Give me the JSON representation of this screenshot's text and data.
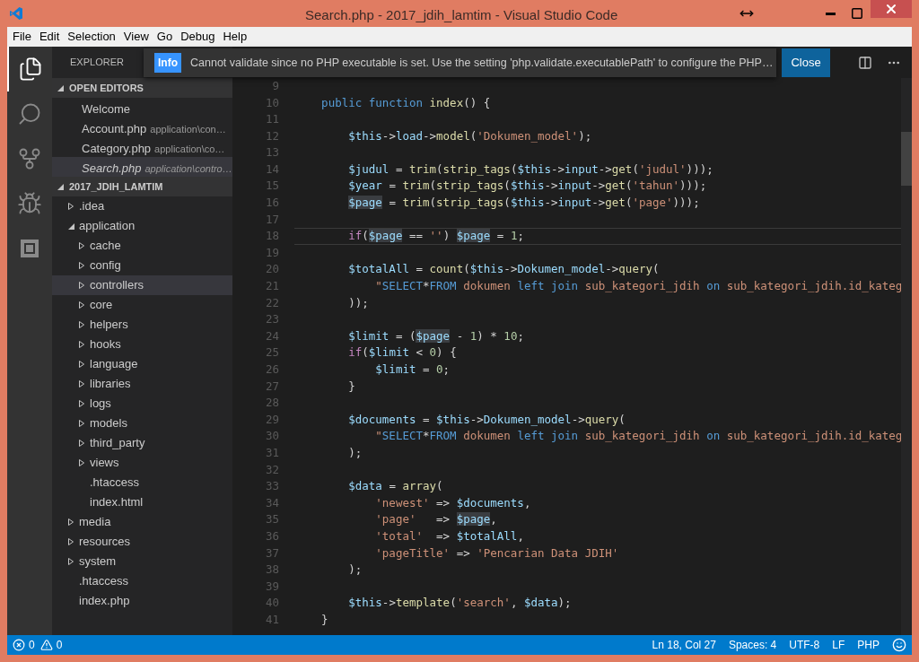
{
  "window": {
    "title": "Search.php - 2017_jdih_lamtim - Visual Studio Code"
  },
  "menu": [
    "File",
    "Edit",
    "Selection",
    "View",
    "Go",
    "Debug",
    "Help"
  ],
  "activity_bar": [
    {
      "kind": "files",
      "selected": true
    },
    {
      "kind": "search",
      "selected": false
    },
    {
      "kind": "git",
      "selected": false
    },
    {
      "kind": "debug",
      "selected": false
    },
    {
      "kind": "extensions",
      "selected": false
    }
  ],
  "notification": {
    "badge": "Info",
    "message": "Cannot validate since no PHP executable is set. Use the setting 'php.validate.executablePath' to configure the PHP…",
    "button": "Close"
  },
  "sidebar": {
    "title": "EXPLORER",
    "open_editors": {
      "title": "OPEN EDITORS",
      "expanded": true,
      "items": [
        {
          "name": "Welcome",
          "selected": false,
          "preview": false
        },
        {
          "name": "Account.php",
          "path": "application\\con…",
          "selected": false,
          "preview": false
        },
        {
          "name": "Category.php",
          "path": "application\\co…",
          "selected": false,
          "preview": false
        },
        {
          "name": "Search.php",
          "path": "application\\contro…",
          "selected": true,
          "preview": true
        }
      ]
    },
    "project": {
      "title": "2017_JDIH_LAMTIM",
      "expanded": true,
      "tree": [
        {
          "name": ".idea",
          "kind": "folder",
          "expanded": false,
          "selected": false
        },
        {
          "name": "application",
          "kind": "folder",
          "expanded": true,
          "selected": false,
          "children": [
            {
              "name": "cache",
              "kind": "folder",
              "expanded": false,
              "selected": false
            },
            {
              "name": "config",
              "kind": "folder",
              "expanded": false,
              "selected": false
            },
            {
              "name": "controllers",
              "kind": "folder",
              "expanded": false,
              "selected": true
            },
            {
              "name": "core",
              "kind": "folder",
              "expanded": false,
              "selected": false
            },
            {
              "name": "helpers",
              "kind": "folder",
              "expanded": false,
              "selected": false
            },
            {
              "name": "hooks",
              "kind": "folder",
              "expanded": false,
              "selected": false
            },
            {
              "name": "language",
              "kind": "folder",
              "expanded": false,
              "selected": false
            },
            {
              "name": "libraries",
              "kind": "folder",
              "expanded": false,
              "selected": false
            },
            {
              "name": "logs",
              "kind": "folder",
              "expanded": false,
              "selected": false
            },
            {
              "name": "models",
              "kind": "folder",
              "expanded": false,
              "selected": false
            },
            {
              "name": "third_party",
              "kind": "folder",
              "expanded": false,
              "selected": false
            },
            {
              "name": "views",
              "kind": "folder",
              "expanded": false,
              "selected": false
            },
            {
              "name": ".htaccess",
              "kind": "file",
              "selected": false
            },
            {
              "name": "index.html",
              "kind": "file",
              "selected": false
            }
          ]
        },
        {
          "name": "media",
          "kind": "folder",
          "expanded": false,
          "selected": false
        },
        {
          "name": "resources",
          "kind": "folder",
          "expanded": false,
          "selected": false
        },
        {
          "name": "system",
          "kind": "folder",
          "expanded": false,
          "selected": false
        },
        {
          "name": ".htaccess",
          "kind": "file",
          "selected": false
        },
        {
          "name": "index.php",
          "kind": "file",
          "selected": false
        }
      ]
    }
  },
  "editor": {
    "lines": [
      {
        "number": "9",
        "current": false
      },
      {
        "number": "10",
        "current": false,
        "tokens": [
          {
            "kind": "kw",
            "text": "    public function"
          },
          {
            "kind": "fn",
            "text": " index"
          },
          {
            "kind": "p",
            "text": "() {"
          }
        ]
      },
      {
        "number": "11",
        "current": false
      },
      {
        "number": "12",
        "current": false,
        "tokens": [
          {
            "kind": "var",
            "text": "        $this"
          },
          {
            "kind": "p",
            "text": "->"
          },
          {
            "kind": "var",
            "text": "load"
          },
          {
            "kind": "p",
            "text": "->"
          },
          {
            "kind": "fn",
            "text": "model"
          },
          {
            "kind": "p",
            "text": "("
          },
          {
            "kind": "str",
            "text": "'Dokumen_model'"
          },
          {
            "kind": "p",
            "text": ");"
          }
        ]
      },
      {
        "number": "13",
        "current": false
      },
      {
        "number": "14",
        "current": false,
        "tokens": [
          {
            "kind": "var",
            "text": "        $judul"
          },
          {
            "kind": "p",
            "text": " = "
          },
          {
            "kind": "fn",
            "text": "trim"
          },
          {
            "kind": "p",
            "text": "("
          },
          {
            "kind": "fn",
            "text": "strip_tags"
          },
          {
            "kind": "p",
            "text": "("
          },
          {
            "kind": "var",
            "text": "$this"
          },
          {
            "kind": "p",
            "text": "->"
          },
          {
            "kind": "var",
            "text": "input"
          },
          {
            "kind": "p",
            "text": "->"
          },
          {
            "kind": "fn",
            "text": "get"
          },
          {
            "kind": "p",
            "text": "("
          },
          {
            "kind": "str",
            "text": "'judul'"
          },
          {
            "kind": "p",
            "text": ")));"
          }
        ]
      },
      {
        "number": "15",
        "current": false,
        "tokens": [
          {
            "kind": "var",
            "text": "        $year"
          },
          {
            "kind": "p",
            "text": " = "
          },
          {
            "kind": "fn",
            "text": "trim"
          },
          {
            "kind": "p",
            "text": "("
          },
          {
            "kind": "fn",
            "text": "strip_tags"
          },
          {
            "kind": "p",
            "text": "("
          },
          {
            "kind": "var",
            "text": "$this"
          },
          {
            "kind": "p",
            "text": "->"
          },
          {
            "kind": "var",
            "text": "input"
          },
          {
            "kind": "p",
            "text": "->"
          },
          {
            "kind": "fn",
            "text": "get"
          },
          {
            "kind": "p",
            "text": "("
          },
          {
            "kind": "str",
            "text": "'tahun'"
          },
          {
            "kind": "p",
            "text": ")));"
          }
        ]
      },
      {
        "number": "16",
        "current": false,
        "tokens": [
          {
            "kind": "var",
            "text": "        $page",
            "highlighted": true
          },
          {
            "kind": "p",
            "text": " = "
          },
          {
            "kind": "fn",
            "text": "trim"
          },
          {
            "kind": "p",
            "text": "("
          },
          {
            "kind": "fn",
            "text": "strip_tags"
          },
          {
            "kind": "p",
            "text": "("
          },
          {
            "kind": "var",
            "text": "$this"
          },
          {
            "kind": "p",
            "text": "->"
          },
          {
            "kind": "var",
            "text": "input"
          },
          {
            "kind": "p",
            "text": "->"
          },
          {
            "kind": "fn",
            "text": "get"
          },
          {
            "kind": "p",
            "text": "("
          },
          {
            "kind": "str",
            "text": "'page'"
          },
          {
            "kind": "p",
            "text": ")));"
          }
        ]
      },
      {
        "number": "17",
        "current": false
      },
      {
        "number": "18",
        "current": true,
        "tokens": [
          {
            "kind": "ctl",
            "text": "        if"
          },
          {
            "kind": "p",
            "text": "("
          },
          {
            "kind": "var",
            "text": "$page",
            "highlighted": true
          },
          {
            "kind": "p",
            "text": " == "
          },
          {
            "kind": "str",
            "text": "''"
          },
          {
            "kind": "p",
            "text": ") "
          },
          {
            "kind": "var",
            "text": "$page",
            "highlighted": true
          },
          {
            "kind": "p",
            "text": " = "
          },
          {
            "kind": "num",
            "text": "1"
          },
          {
            "kind": "p",
            "text": ";"
          }
        ]
      },
      {
        "number": "19",
        "current": false
      },
      {
        "number": "20",
        "current": false,
        "tokens": [
          {
            "kind": "var",
            "text": "        $totalAll"
          },
          {
            "kind": "p",
            "text": " = "
          },
          {
            "kind": "fn",
            "text": "count"
          },
          {
            "kind": "p",
            "text": "("
          },
          {
            "kind": "var",
            "text": "$this"
          },
          {
            "kind": "p",
            "text": "->"
          },
          {
            "kind": "var",
            "text": "Dokumen_model"
          },
          {
            "kind": "p",
            "text": "->"
          },
          {
            "kind": "fn",
            "text": "query"
          },
          {
            "kind": "p",
            "text": "("
          }
        ]
      },
      {
        "number": "21",
        "current": false,
        "tokens": [
          {
            "kind": "str",
            "text": "            \""
          },
          {
            "kind": "kw",
            "text": "SELECT"
          },
          {
            "kind": "p",
            "text": "*"
          },
          {
            "kind": "kw",
            "text": "FROM"
          },
          {
            "kind": "str",
            "text": " dokumen "
          },
          {
            "kind": "kw",
            "text": "left join"
          },
          {
            "kind": "str",
            "text": " sub_kategori_jdih "
          },
          {
            "kind": "kw",
            "text": "on"
          },
          {
            "kind": "str",
            "text": " sub_kategori_jdih.id_kateg"
          }
        ]
      },
      {
        "number": "22",
        "current": false,
        "tokens": [
          {
            "kind": "p",
            "text": "        ));"
          }
        ]
      },
      {
        "number": "23",
        "current": false
      },
      {
        "number": "24",
        "current": false,
        "tokens": [
          {
            "kind": "var",
            "text": "        $limit"
          },
          {
            "kind": "p",
            "text": " = ("
          },
          {
            "kind": "var",
            "text": "$page",
            "highlighted": true
          },
          {
            "kind": "p",
            "text": " - "
          },
          {
            "kind": "num",
            "text": "1"
          },
          {
            "kind": "p",
            "text": ") * "
          },
          {
            "kind": "num",
            "text": "10"
          },
          {
            "kind": "p",
            "text": ";"
          }
        ]
      },
      {
        "number": "25",
        "current": false,
        "tokens": [
          {
            "kind": "ctl",
            "text": "        if"
          },
          {
            "kind": "p",
            "text": "("
          },
          {
            "kind": "var",
            "text": "$limit"
          },
          {
            "kind": "p",
            "text": " < "
          },
          {
            "kind": "num",
            "text": "0"
          },
          {
            "kind": "p",
            "text": ") {"
          }
        ]
      },
      {
        "number": "26",
        "current": false,
        "tokens": [
          {
            "kind": "var",
            "text": "            $limit"
          },
          {
            "kind": "p",
            "text": " = "
          },
          {
            "kind": "num",
            "text": "0"
          },
          {
            "kind": "p",
            "text": ";"
          }
        ]
      },
      {
        "number": "27",
        "current": false,
        "tokens": [
          {
            "kind": "p",
            "text": "        }"
          }
        ]
      },
      {
        "number": "28",
        "current": false
      },
      {
        "number": "29",
        "current": false,
        "tokens": [
          {
            "kind": "var",
            "text": "        $documents"
          },
          {
            "kind": "p",
            "text": " = "
          },
          {
            "kind": "var",
            "text": "$this"
          },
          {
            "kind": "p",
            "text": "->"
          },
          {
            "kind": "var",
            "text": "Dokumen_model"
          },
          {
            "kind": "p",
            "text": "->"
          },
          {
            "kind": "fn",
            "text": "query"
          },
          {
            "kind": "p",
            "text": "("
          }
        ]
      },
      {
        "number": "30",
        "current": false,
        "tokens": [
          {
            "kind": "str",
            "text": "            \""
          },
          {
            "kind": "kw",
            "text": "SELECT"
          },
          {
            "kind": "p",
            "text": "*"
          },
          {
            "kind": "kw",
            "text": "FROM"
          },
          {
            "kind": "str",
            "text": " dokumen "
          },
          {
            "kind": "kw",
            "text": "left join"
          },
          {
            "kind": "str",
            "text": " sub_kategori_jdih "
          },
          {
            "kind": "kw",
            "text": "on"
          },
          {
            "kind": "str",
            "text": " sub_kategori_jdih.id_kateg"
          }
        ]
      },
      {
        "number": "31",
        "current": false,
        "tokens": [
          {
            "kind": "p",
            "text": "        );"
          }
        ]
      },
      {
        "number": "32",
        "current": false
      },
      {
        "number": "33",
        "current": false,
        "tokens": [
          {
            "kind": "var",
            "text": "        $data"
          },
          {
            "kind": "p",
            "text": " = "
          },
          {
            "kind": "fn",
            "text": "array"
          },
          {
            "kind": "p",
            "text": "("
          }
        ]
      },
      {
        "number": "34",
        "current": false,
        "tokens": [
          {
            "kind": "str",
            "text": "            'newest'"
          },
          {
            "kind": "p",
            "text": " => "
          },
          {
            "kind": "var",
            "text": "$documents"
          },
          {
            "kind": "p",
            "text": ","
          }
        ]
      },
      {
        "number": "35",
        "current": false,
        "tokens": [
          {
            "kind": "str",
            "text": "            'page'"
          },
          {
            "kind": "p",
            "text": "   => "
          },
          {
            "kind": "var",
            "text": "$page",
            "highlighted": true
          },
          {
            "kind": "p",
            "text": ","
          }
        ]
      },
      {
        "number": "36",
        "current": false,
        "tokens": [
          {
            "kind": "str",
            "text": "            'total'"
          },
          {
            "kind": "p",
            "text": "  => "
          },
          {
            "kind": "var",
            "text": "$totalAll"
          },
          {
            "kind": "p",
            "text": ","
          }
        ]
      },
      {
        "number": "37",
        "current": false,
        "tokens": [
          {
            "kind": "str",
            "text": "            'pageTitle'"
          },
          {
            "kind": "p",
            "text": " => "
          },
          {
            "kind": "str",
            "text": "'Pencarian Data JDIH'"
          }
        ]
      },
      {
        "number": "38",
        "current": false,
        "tokens": [
          {
            "kind": "p",
            "text": "        );"
          }
        ]
      },
      {
        "number": "39",
        "current": false
      },
      {
        "number": "40",
        "current": false,
        "tokens": [
          {
            "kind": "var",
            "text": "        $this"
          },
          {
            "kind": "p",
            "text": "->"
          },
          {
            "kind": "fn",
            "text": "template"
          },
          {
            "kind": "p",
            "text": "("
          },
          {
            "kind": "str",
            "text": "'search'"
          },
          {
            "kind": "p",
            "text": ", "
          },
          {
            "kind": "var",
            "text": "$data"
          },
          {
            "kind": "p",
            "text": ");"
          }
        ]
      },
      {
        "number": "41",
        "current": false,
        "tokens": [
          {
            "kind": "p",
            "text": "    }"
          }
        ]
      }
    ]
  },
  "status_bar": {
    "errors": "0",
    "warnings": "0",
    "items": [
      "Ln 18, Col 27",
      "Spaces: 4",
      "UTF-8",
      "LF",
      "PHP"
    ]
  }
}
